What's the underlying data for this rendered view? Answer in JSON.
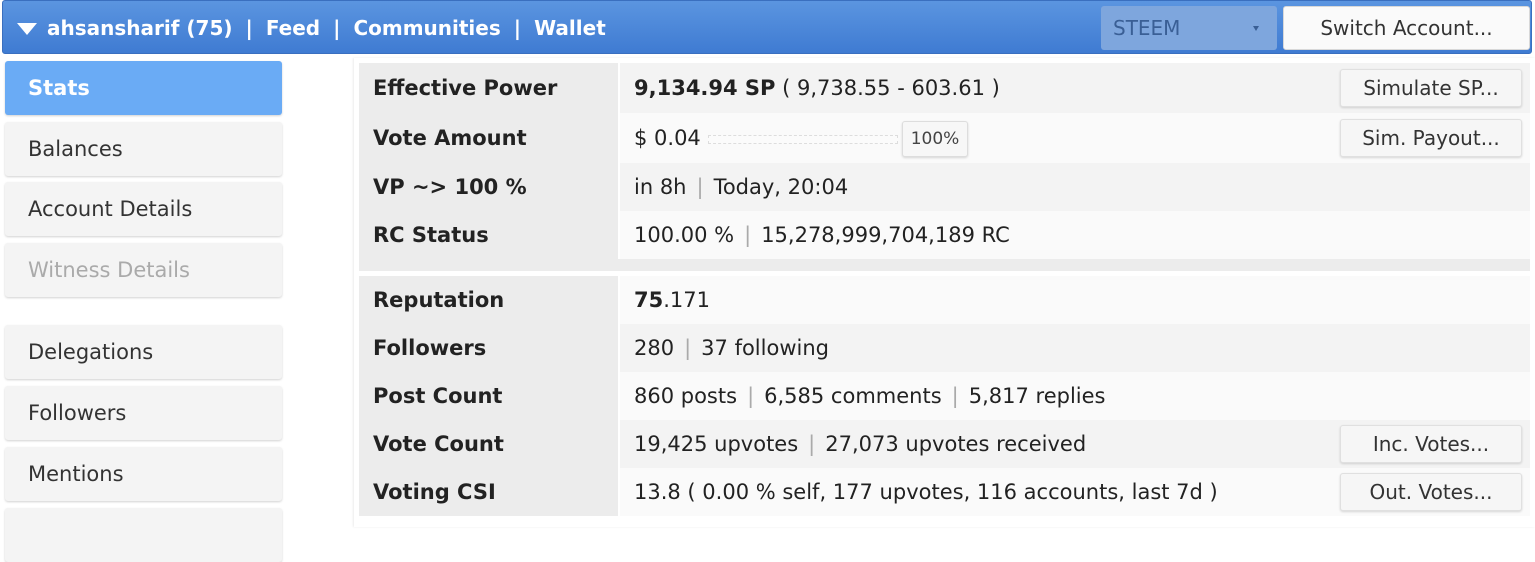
{
  "header": {
    "account": "ahsansharif (75)",
    "nav": [
      "Feed",
      "Communities",
      "Wallet"
    ],
    "currency_select": "STEEM",
    "switch_account": "Switch Account..."
  },
  "sidebar": {
    "items": [
      {
        "label": "Stats",
        "state": "active"
      },
      {
        "label": "Balances",
        "state": "normal"
      },
      {
        "label": "Account Details",
        "state": "normal"
      },
      {
        "label": "Witness Details",
        "state": "disabled"
      },
      {
        "label": "Delegations",
        "state": "normal"
      },
      {
        "label": "Followers",
        "state": "normal"
      },
      {
        "label": "Mentions",
        "state": "normal"
      }
    ]
  },
  "stats": {
    "effective_power": {
      "label": "Effective Power",
      "sp": "9,134.94 SP",
      "detail": "( 9,738.55 - 603.61 )",
      "button": "Simulate SP..."
    },
    "vote_amount": {
      "label": "Vote Amount",
      "value": "$ 0.04",
      "percent": "100%",
      "button": "Sim. Payout..."
    },
    "vp": {
      "label": "VP ~> 100 %",
      "eta": "in 8h",
      "time": "Today, 20:04"
    },
    "rc": {
      "label": "RC Status",
      "percent": "100.00 %",
      "amount": "15,278,999,704,189 RC"
    },
    "reputation": {
      "label": "Reputation",
      "whole": "75",
      "decimal": ".171"
    },
    "followers": {
      "label": "Followers",
      "count": "280",
      "following": "37 following"
    },
    "post_count": {
      "label": "Post Count",
      "posts": "860 posts",
      "comments": "6,585 comments",
      "replies": "5,817 replies"
    },
    "vote_count": {
      "label": "Vote Count",
      "upvotes": "19,425 upvotes",
      "received": "27,073 upvotes received",
      "button": "Inc. Votes..."
    },
    "voting_csi": {
      "label": "Voting CSI",
      "value": "13.8 ( 0.00 % self, 177 upvotes, 116 accounts, last 7d )",
      "button": "Out. Votes..."
    }
  }
}
